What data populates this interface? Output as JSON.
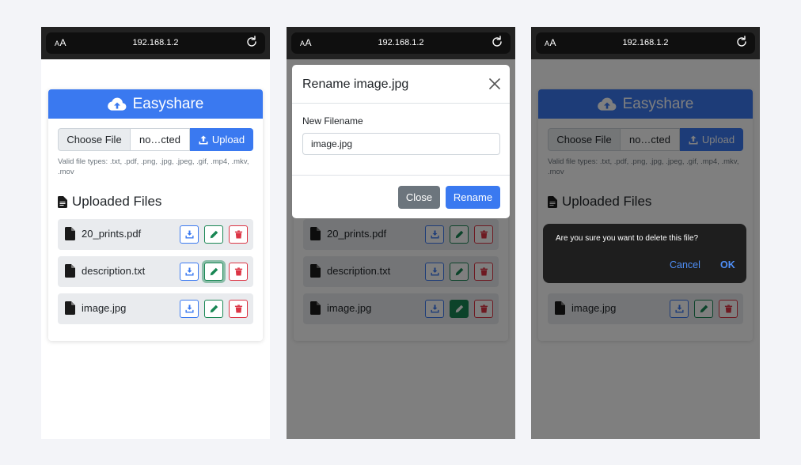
{
  "browser": {
    "text_size_label": "AA",
    "url": "192.168.1.2"
  },
  "app": {
    "title": "Easyshare",
    "choose_file_label": "Choose File",
    "no_file_label": "no…cted",
    "upload_label": "Upload",
    "valid_types": "Valid file types: .txt, .pdf, .png, .jpg, .jpeg, .gif, .mp4, .mkv, .mov",
    "uploaded_title": "Uploaded Files",
    "files": [
      {
        "name": "20_prints.pdf"
      },
      {
        "name": "description.txt"
      },
      {
        "name": "image.jpg"
      }
    ]
  },
  "rename_modal": {
    "title": "Rename image.jpg",
    "label": "New Filename",
    "input_value": "image.jpg",
    "close_label": "Close",
    "rename_label": "Rename"
  },
  "confirm_dialog": {
    "message": "Are you sure you want to delete this file?",
    "cancel_label": "Cancel",
    "ok_label": "OK"
  },
  "colors": {
    "primary": "#3a79f0",
    "success": "#198754",
    "danger": "#dc3545",
    "secondary": "#6c757d"
  }
}
